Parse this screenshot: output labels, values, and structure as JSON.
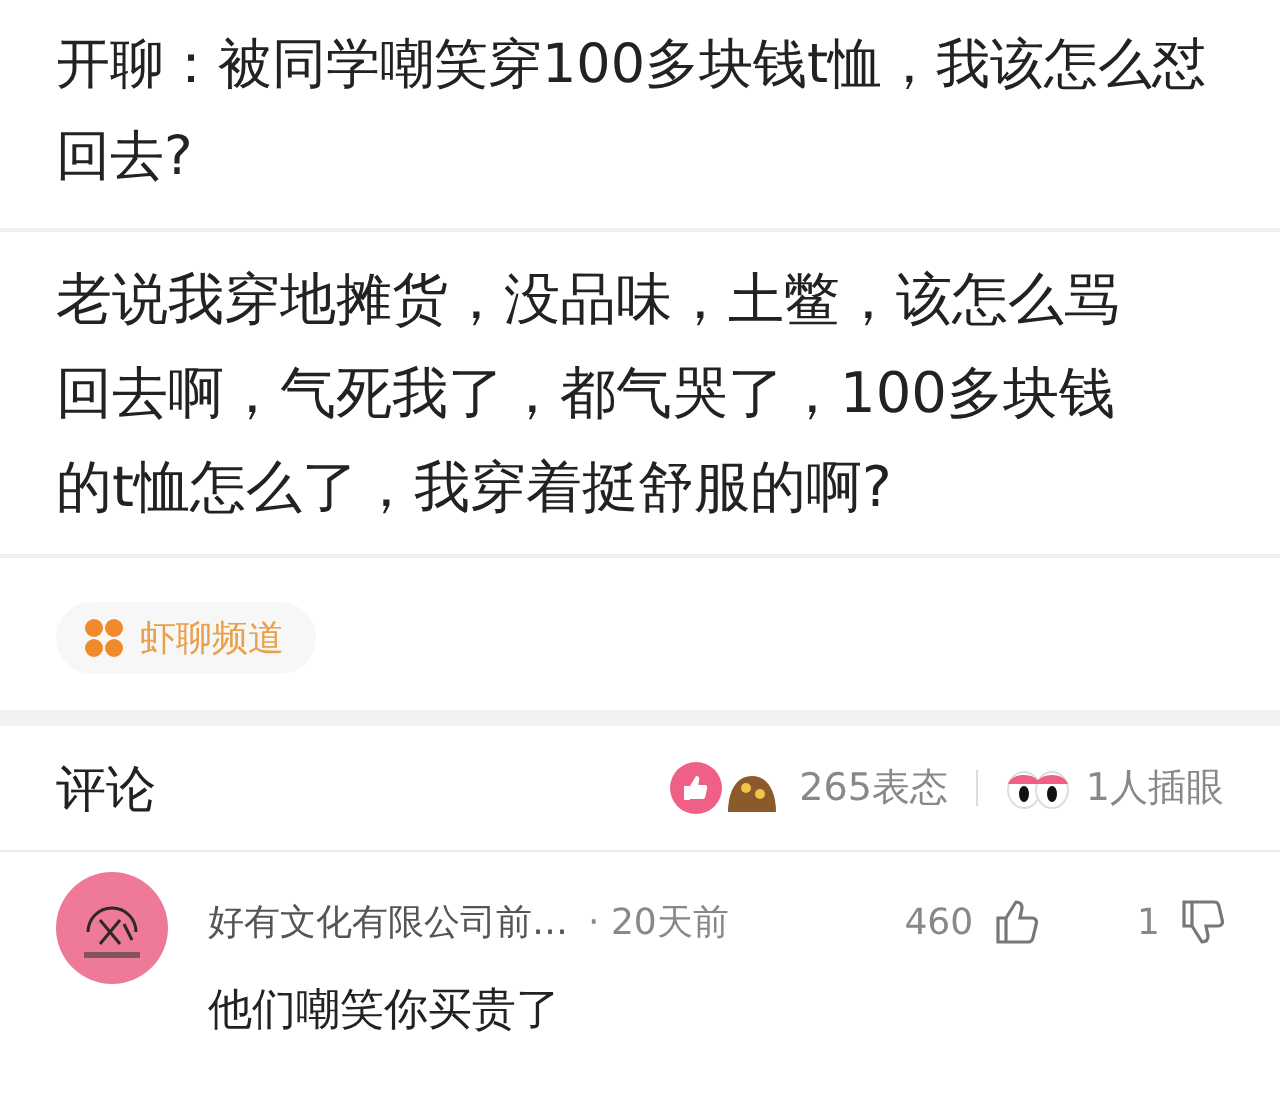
{
  "post": {
    "title": "开聊：被同学嘲笑穿100多块钱t恤，我该怎么怼回去?",
    "quote": "老说我穿地摊货，没品味，土鳖，该怎么骂回去啊，气死我了，都气哭了，100多块钱的t恤怎么了，我穿着挺舒服的啊?",
    "channel": "虾聊频道"
  },
  "comments_header": {
    "title": "评论",
    "reactions": "265表态",
    "views": "1人插眼"
  },
  "comments": [
    {
      "author": "好有文化有限公司前…",
      "time": "· 20天前",
      "likes": "460",
      "dislikes": "1",
      "text": "他们嘲笑你买贵了"
    }
  ]
}
